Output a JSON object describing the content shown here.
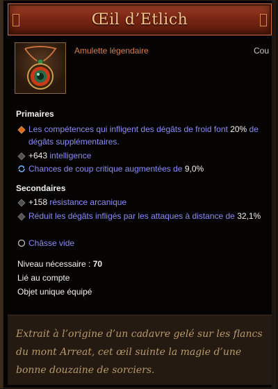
{
  "item": {
    "name": "Œil d’Etlich",
    "type": "Amulette légendaire",
    "slot": "Cou"
  },
  "primary": {
    "title": "Primaires",
    "lines": [
      {
        "pre": "Les compétences qui infligent des dégâts de froid font ",
        "value": "20%",
        "post": " de dégâts supplémentaires.",
        "icon": "orange-diamond-bullet-icon"
      },
      {
        "pre": "",
        "value": "+643",
        "post": " intelligence",
        "icon": "gray-diamond-bullet-icon"
      },
      {
        "pre": "Chances de coup critique augmentées de ",
        "value": "9,0%",
        "post": "",
        "icon": "reroll-arrows-icon"
      }
    ]
  },
  "secondary": {
    "title": "Secondaires",
    "lines": [
      {
        "pre": "",
        "value": "+158",
        "post": " résistance arcanique",
        "icon": "gray-diamond-bullet-icon"
      },
      {
        "pre": "Réduit les dégâts infligés par les attaques à distance de ",
        "value": "32,1%",
        "post": "",
        "icon": "gray-diamond-bullet-icon"
      },
      {
        "pre": "Châsse vide",
        "value": "",
        "post": "",
        "icon": "empty-socket-icon"
      }
    ]
  },
  "requirements": {
    "level_label": "Niveau nécessaire : ",
    "level_value": "70",
    "bound": "Lié au compte",
    "unique": "Objet unique équipé"
  },
  "flavor": "Extrait à l’origine d’un cadavre gelé sur les flancs du mont Arreat, cet œil suinte la magie d’une bonne douzaine de sorciers.",
  "colors": {
    "legendary": "#d87f4d",
    "magic": "#8c8cf8",
    "flavor": "#b89a6a"
  }
}
